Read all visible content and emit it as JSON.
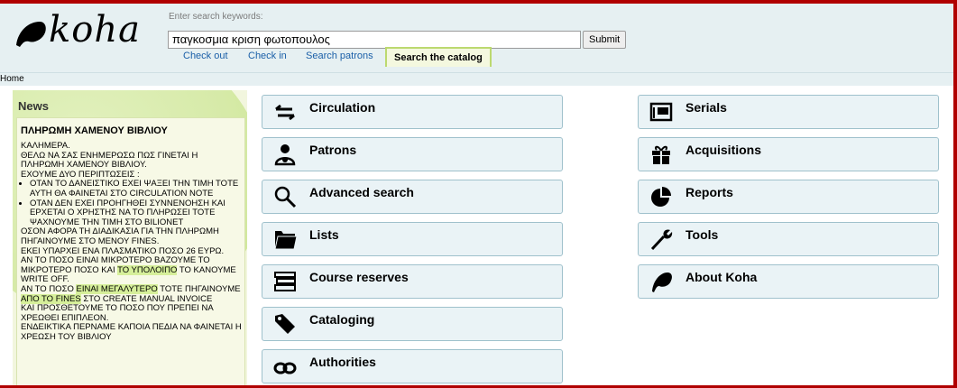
{
  "app": {
    "logo_text": "koha"
  },
  "search": {
    "hint": "Enter search keywords:",
    "value": "παγκοσμια κριση φωτοπουλος",
    "submit_label": "Submit"
  },
  "tabs": {
    "check_out": "Check out",
    "check_in": "Check in",
    "search_patrons": "Search patrons",
    "search_catalog": "Search the catalog"
  },
  "breadcrumb": {
    "home": "Home"
  },
  "news": {
    "heading": "News",
    "item_title": "ΠΛΗΡΩΜΗ ΧΑΜΕΝΟΥ ΒΙΒΛΙΟΥ",
    "lines": {
      "l1": "ΚΑΛΗΜΕΡΑ.",
      "l2": "ΘΕΛΩ ΝΑ ΣΑΣ ΕΝΗΜΕΡΩΣΩ ΠΩΣ ΓΙΝΕΤΑΙ Η ΠΛΗΡΩΜΗ ΧΑΜΕΝΟΥ ΒΙΒΛΙΟΥ.",
      "l3": "ΕΧΟΥΜΕ ΔΥΟ ΠΕΡΙΠΤΩΣΕΙΣ :",
      "b1": "ΟΤΑΝ ΤΟ ΔΑΝΕΙΣΤΙΚΟ ΕΧΕΙ ΨΑΞΕΙ ΤΗΝ ΤΙΜΗ ΤΟΤΕ ΑΥΤΗ ΘΑ ΦΑΙΝΕΤΑΙ ΣΤΟ CIRCULATION NOTE",
      "b2": "ΟΤΑΝ ΔΕΝ ΕΧΕΙ ΠΡΟΗΓΗΘΕΙ ΣΥΝΝΕΝΟΗΣΗ ΚΑΙ ΕΡΧΕΤΑΙ Ο ΧΡΗΣΤΗΣ ΝΑ ΤΟ ΠΛΗΡΩΣΕΙ ΤΟΤΕ ΨΑΧΝΟΥΜΕ ΤΗΝ ΤΙΜΗ ΣΤΟ BILIONET",
      "l4": "ΟΣΟΝ ΑΦΟΡΑ ΤΗ ΔΙΑΔΙΚΑΣΙΑ ΓΙΑ ΤΗΝ ΠΛΗΡΩΜΗ ΠΗΓΑΙΝΟΥΜΕ ΣΤΟ ΜΕΝΟΥ FINES.",
      "l5": "ΕΚΕΙ ΥΠΑΡΧΕΙ ΕΝΑ ΠΛΑΣΜΑΤΙΚΟ ΠΟΣΟ 26 ΕΥΡΩ.",
      "l6a": "ΑΝ ΤΟ ΠΟΣΟ ΕΙΝΑΙ ΜΙΚΡΟΤΕΡΟ ΒΑΖΟΥΜΕ ΤΟ ΜΙΚΡΟΤΕΡΟ ΠΟΣΟ ΚΑΙ ",
      "l6b": "ΤΟ ΥΠΟΛΟΙΠΟ",
      "l6c": " ΤΟ ΚΑΝΟΥΜΕ WRITE OFF.",
      "l7a": "ΑΝ ΤΟ ΠΟΣΟ ",
      "l7b": "ΕΙΝΑΙ ΜΕΓΑΛΥΤΕΡΟ",
      "l7c": " ΤΟΤΕ ΠΗΓΑΙΝΟΥΜΕ ",
      "l7d": "ΑΠΟ ΤΟ FINES",
      "l7e": " ΣΤΟ CREATE MANUAL INVOICE",
      "l8": "ΚΑΙ ΠΡΟΣΘΕΤΟΥΜΕ ΤΟ ΠΟΣΟ ΠΟΥ ΠΡΕΠΕΙ ΝΑ ΧΡΕΩΘΕΙ ΕΠΙΠΛΕΟΝ.",
      "l9": "ΕΝΔΕΙΚΤΙΚΑ ΠΕΡΝΑΜΕ ΚΑΠΟΙΑ ΠΕΔΙΑ ΝΑ ΦΑΙΝΕΤΑΙ Η ΧΡΕΩΣΗ ΤΟΥ ΒΙΒΛΙΟΥ"
    }
  },
  "menu": {
    "circulation": "Circulation",
    "patrons": "Patrons",
    "advanced_search": "Advanced search",
    "lists": "Lists",
    "course_reserves": "Course reserves",
    "cataloging": "Cataloging",
    "authorities": "Authorities",
    "serials": "Serials",
    "acquisitions": "Acquisitions",
    "reports": "Reports",
    "tools": "Tools",
    "about": "About Koha"
  }
}
